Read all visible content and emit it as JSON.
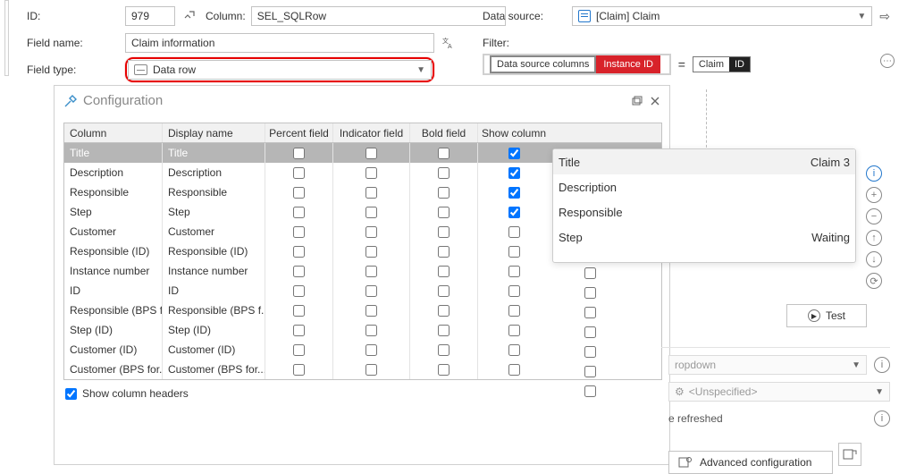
{
  "top": {
    "id_label": "ID:",
    "id_value": "979",
    "column_label": "Column:",
    "column_value": "SEL_SQLRow",
    "field_name_label": "Field name:",
    "field_name_value": "Claim information",
    "field_type_label": "Field type:",
    "field_type_value": "Data row"
  },
  "right": {
    "ds_label": "Data source:",
    "ds_value": "[Claim] Claim",
    "filter_label": "Filter:",
    "chip_cols": "Data source columns",
    "chip_instance": "Instance ID",
    "chip_claim_left": "Claim",
    "chip_claim_right": "ID"
  },
  "cfg": {
    "title": "Configuration",
    "headers": {
      "column": "Column",
      "display": "Display name",
      "percent": "Percent field",
      "indicator": "Indicator field",
      "bold": "Bold field",
      "show": "Show column"
    },
    "rows": [
      {
        "col": "Title",
        "disp": "Title",
        "show": true,
        "sel": true
      },
      {
        "col": "Description",
        "disp": "Description",
        "show": true
      },
      {
        "col": "Responsible",
        "disp": "Responsible",
        "show": true
      },
      {
        "col": "Step",
        "disp": "Step",
        "show": true
      },
      {
        "col": "Customer",
        "disp": "Customer",
        "show": false
      },
      {
        "col": "Responsible (ID)",
        "disp": "Responsible (ID)",
        "show": false
      },
      {
        "col": "Instance number",
        "disp": "Instance number",
        "show": false
      },
      {
        "col": "ID",
        "disp": "ID",
        "show": false
      },
      {
        "col": "Responsible (BPS f...",
        "disp": "Responsible (BPS f...",
        "show": false
      },
      {
        "col": "Step (ID)",
        "disp": "Step (ID)",
        "show": false
      },
      {
        "col": "Customer (ID)",
        "disp": "Customer (ID)",
        "show": false
      },
      {
        "col": "Customer (BPS for...",
        "disp": "Customer (BPS for...",
        "show": false
      }
    ],
    "show_headers_label": "Show column headers"
  },
  "preview": {
    "rows": [
      {
        "label": "Title",
        "value": "Claim 3"
      },
      {
        "label": "Description",
        "value": ""
      },
      {
        "label": "Responsible",
        "value": ""
      },
      {
        "label": "Step",
        "value": "Waiting"
      }
    ]
  },
  "bottom": {
    "dropdown_text": "ropdown",
    "unspecified_text": "<Unspecified>",
    "refreshed_text": "e refreshed",
    "adv_label": "Advanced configuration",
    "test_label": "Test"
  }
}
